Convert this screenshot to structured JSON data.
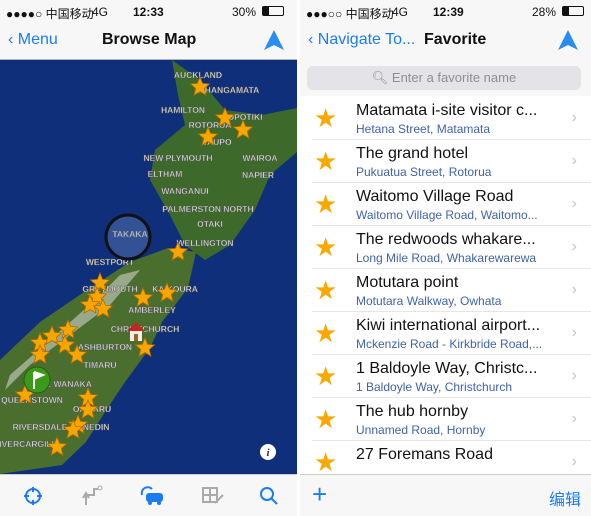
{
  "left": {
    "status": {
      "carrier": "●●●●○ 中国移动",
      "network": "4G",
      "time": "12:33",
      "battery": "30%"
    },
    "nav": {
      "back_label": "Menu",
      "title": "Browse Map"
    },
    "map": {
      "labels": [
        "AUCKLAND",
        "WHANGAMATA",
        "HAMILTON",
        "ROTORUA",
        "OPOTIKI",
        "TAUPO",
        "NEW PLYMOUTH",
        "WAIROA",
        "ELTHAM",
        "NAPIER",
        "WANGANUI",
        "PALMERSTON NORTH",
        "OTAKI",
        "TAKAKA",
        "WELLINGTON",
        "WESTPORT",
        "GREYMOUTH",
        "KAIKOURA",
        "AMBERLEY",
        "CHRISTCHURCH",
        "ASHBURTON",
        "TIMARU",
        "LAKE WANAKA",
        "QUEENSTOWN",
        "OAMARU",
        "RIVERSDALE",
        "DUNEDIN",
        "INVERCARGILL"
      ],
      "colors": {
        "ocean": "#0f2f7a",
        "land": "#3d6a2a",
        "star": "#f7a600"
      }
    },
    "tabbar": [
      "locate-icon",
      "route-icon",
      "car-icon",
      "manage-icon",
      "search-icon"
    ]
  },
  "right": {
    "status": {
      "carrier": "●●●○○ 中国移动",
      "network": "4G",
      "time": "12:39",
      "battery": "28%"
    },
    "nav": {
      "back_label": "Navigate To...",
      "title": "Favorite"
    },
    "search_placeholder": "Enter a favorite name",
    "favorites": [
      {
        "title": "Matamata i-site visitor c...",
        "subtitle": "Hetana Street, Matamata"
      },
      {
        "title": "The grand hotel",
        "subtitle": "Pukuatua Street, Rotorua"
      },
      {
        "title": "Waitomo Village Road",
        "subtitle": "Waitomo Village Road, Waitomo..."
      },
      {
        "title": "The redwoods whakare...",
        "subtitle": "Long Mile Road, Whakarewarewa"
      },
      {
        "title": "Motutara point",
        "subtitle": "Motutara Walkway, Owhata"
      },
      {
        "title": "Kiwi international airport...",
        "subtitle": "Mckenzie Road - Kirkbride Road,..."
      },
      {
        "title": "1 Baldoyle Way, Christc...",
        "subtitle": "1 Baldoyle Way, Christchurch"
      },
      {
        "title": "The hub hornby",
        "subtitle": "Unnamed Road, Hornby"
      },
      {
        "title": "27 Foremans Road",
        "subtitle": ""
      }
    ],
    "toolbar": {
      "add_label": "+",
      "edit_label": "编辑"
    }
  },
  "accent": "#1a7cf5"
}
